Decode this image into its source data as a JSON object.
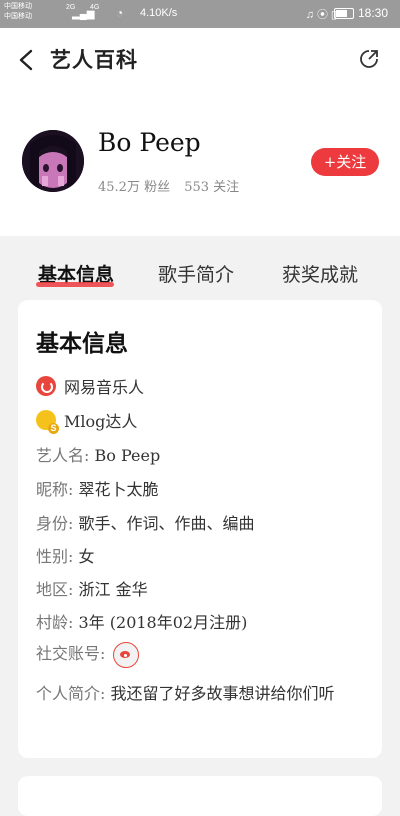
{
  "status_bar": {
    "carrier1": "中国移动",
    "carrier2": "中国移动",
    "network1": "2G",
    "network2": "4G",
    "speed": "4.10K/s",
    "time": "18:30"
  },
  "header": {
    "title": "艺人百科",
    "back_icon": "chevron-left-icon",
    "share_icon": "share-icon"
  },
  "artist": {
    "name": "Bo Peep",
    "fans": "45.2万 粉丝",
    "follows": "553 关注",
    "follow_label": "+关注"
  },
  "tabs": [
    {
      "label": "基本信息",
      "active": true
    },
    {
      "label": "歌手简介",
      "active": false
    },
    {
      "label": "获奖成就",
      "active": false
    }
  ],
  "info": {
    "title": "基本信息",
    "badges": [
      {
        "label": "网易音乐人",
        "icon": "netease-musician-icon"
      },
      {
        "label": "Mlog达人",
        "icon": "mlog-star-icon"
      }
    ],
    "rows": [
      {
        "label": "艺人名:",
        "value": "Bo Peep"
      },
      {
        "label": "昵称:",
        "value": "翠花卜太脆"
      },
      {
        "label": "身份:",
        "value": "歌手、作词、作曲、编曲"
      },
      {
        "label": "性别:",
        "value": "女"
      },
      {
        "label": "地区:",
        "value": "浙江 金华"
      },
      {
        "label": "村龄:",
        "value": "3年 (2018年02月注册)"
      }
    ],
    "social_label": "社交账号:",
    "intro_label": "个人简介:",
    "intro_text": "我还留了好多故事想讲给你们听"
  },
  "colors": {
    "accent": "#ec3a3e",
    "background": "#f2f2f2"
  }
}
